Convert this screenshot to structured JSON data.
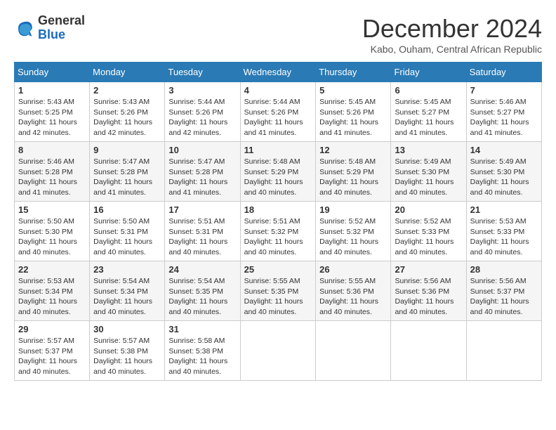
{
  "header": {
    "logo": {
      "general": "General",
      "blue": "Blue"
    },
    "title": "December 2024",
    "subtitle": "Kabo, Ouham, Central African Republic"
  },
  "calendar": {
    "days_of_week": [
      "Sunday",
      "Monday",
      "Tuesday",
      "Wednesday",
      "Thursday",
      "Friday",
      "Saturday"
    ],
    "weeks": [
      [
        null,
        {
          "day": "2",
          "sunrise": "5:43 AM",
          "sunset": "5:26 PM",
          "daylight": "11 hours and 42 minutes."
        },
        {
          "day": "3",
          "sunrise": "5:44 AM",
          "sunset": "5:26 PM",
          "daylight": "11 hours and 42 minutes."
        },
        {
          "day": "4",
          "sunrise": "5:44 AM",
          "sunset": "5:26 PM",
          "daylight": "11 hours and 41 minutes."
        },
        {
          "day": "5",
          "sunrise": "5:45 AM",
          "sunset": "5:26 PM",
          "daylight": "11 hours and 41 minutes."
        },
        {
          "day": "6",
          "sunrise": "5:45 AM",
          "sunset": "5:27 PM",
          "daylight": "11 hours and 41 minutes."
        },
        {
          "day": "7",
          "sunrise": "5:46 AM",
          "sunset": "5:27 PM",
          "daylight": "11 hours and 41 minutes."
        }
      ],
      [
        {
          "day": "1",
          "sunrise": "5:43 AM",
          "sunset": "5:25 PM",
          "daylight": "11 hours and 42 minutes."
        },
        {
          "day": "8",
          "sunrise": "5:46 AM",
          "sunset": "5:28 PM",
          "daylight": "11 hours and 41 minutes."
        },
        {
          "day": "9",
          "sunrise": "5:47 AM",
          "sunset": "5:28 PM",
          "daylight": "11 hours and 41 minutes."
        },
        {
          "day": "10",
          "sunrise": "5:47 AM",
          "sunset": "5:28 PM",
          "daylight": "11 hours and 41 minutes."
        },
        {
          "day": "11",
          "sunrise": "5:48 AM",
          "sunset": "5:29 PM",
          "daylight": "11 hours and 40 minutes."
        },
        {
          "day": "12",
          "sunrise": "5:48 AM",
          "sunset": "5:29 PM",
          "daylight": "11 hours and 40 minutes."
        },
        {
          "day": "13",
          "sunrise": "5:49 AM",
          "sunset": "5:30 PM",
          "daylight": "11 hours and 40 minutes."
        },
        {
          "day": "14",
          "sunrise": "5:49 AM",
          "sunset": "5:30 PM",
          "daylight": "11 hours and 40 minutes."
        }
      ],
      [
        {
          "day": "15",
          "sunrise": "5:50 AM",
          "sunset": "5:30 PM",
          "daylight": "11 hours and 40 minutes."
        },
        {
          "day": "16",
          "sunrise": "5:50 AM",
          "sunset": "5:31 PM",
          "daylight": "11 hours and 40 minutes."
        },
        {
          "day": "17",
          "sunrise": "5:51 AM",
          "sunset": "5:31 PM",
          "daylight": "11 hours and 40 minutes."
        },
        {
          "day": "18",
          "sunrise": "5:51 AM",
          "sunset": "5:32 PM",
          "daylight": "11 hours and 40 minutes."
        },
        {
          "day": "19",
          "sunrise": "5:52 AM",
          "sunset": "5:32 PM",
          "daylight": "11 hours and 40 minutes."
        },
        {
          "day": "20",
          "sunrise": "5:52 AM",
          "sunset": "5:33 PM",
          "daylight": "11 hours and 40 minutes."
        },
        {
          "day": "21",
          "sunrise": "5:53 AM",
          "sunset": "5:33 PM",
          "daylight": "11 hours and 40 minutes."
        }
      ],
      [
        {
          "day": "22",
          "sunrise": "5:53 AM",
          "sunset": "5:34 PM",
          "daylight": "11 hours and 40 minutes."
        },
        {
          "day": "23",
          "sunrise": "5:54 AM",
          "sunset": "5:34 PM",
          "daylight": "11 hours and 40 minutes."
        },
        {
          "day": "24",
          "sunrise": "5:54 AM",
          "sunset": "5:35 PM",
          "daylight": "11 hours and 40 minutes."
        },
        {
          "day": "25",
          "sunrise": "5:55 AM",
          "sunset": "5:35 PM",
          "daylight": "11 hours and 40 minutes."
        },
        {
          "day": "26",
          "sunrise": "5:55 AM",
          "sunset": "5:36 PM",
          "daylight": "11 hours and 40 minutes."
        },
        {
          "day": "27",
          "sunrise": "5:56 AM",
          "sunset": "5:36 PM",
          "daylight": "11 hours and 40 minutes."
        },
        {
          "day": "28",
          "sunrise": "5:56 AM",
          "sunset": "5:37 PM",
          "daylight": "11 hours and 40 minutes."
        }
      ],
      [
        {
          "day": "29",
          "sunrise": "5:57 AM",
          "sunset": "5:37 PM",
          "daylight": "11 hours and 40 minutes."
        },
        {
          "day": "30",
          "sunrise": "5:57 AM",
          "sunset": "5:38 PM",
          "daylight": "11 hours and 40 minutes."
        },
        {
          "day": "31",
          "sunrise": "5:58 AM",
          "sunset": "5:38 PM",
          "daylight": "11 hours and 40 minutes."
        },
        null,
        null,
        null,
        null
      ]
    ]
  }
}
